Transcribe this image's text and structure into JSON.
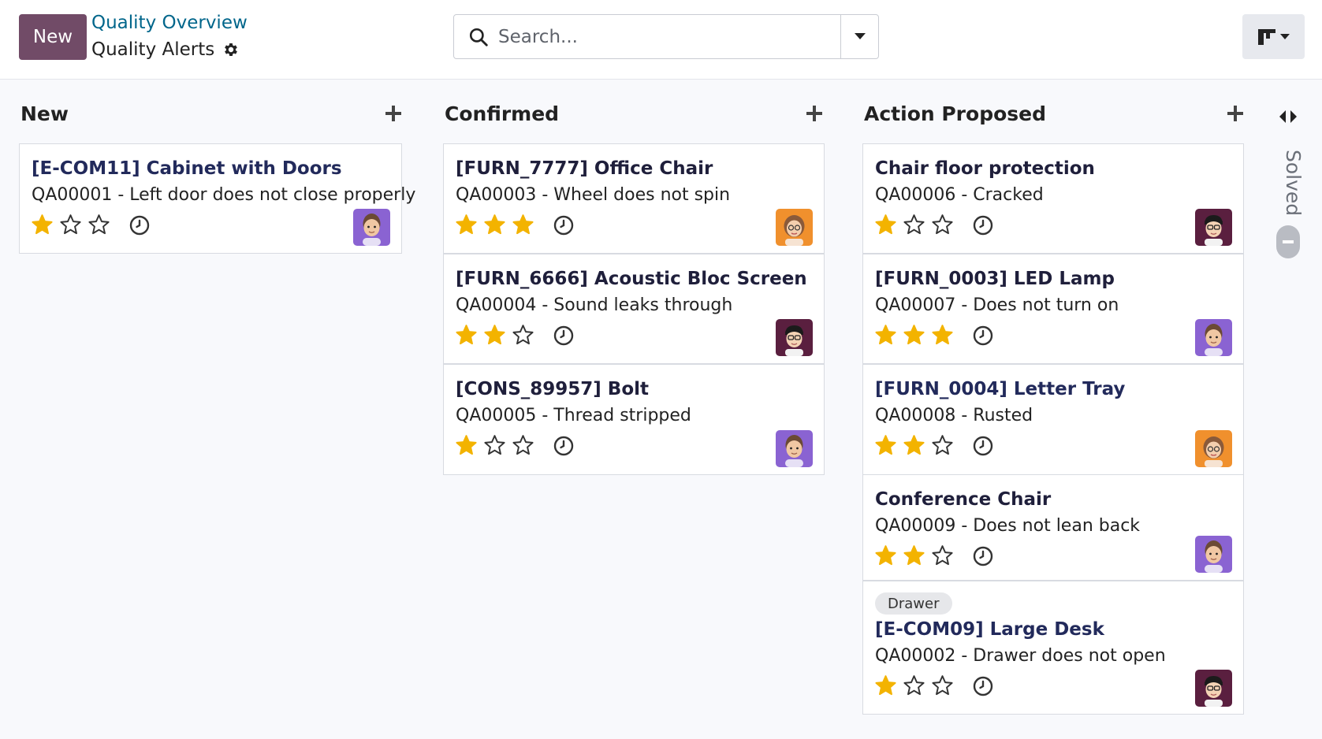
{
  "control_panel": {
    "new_button": "New",
    "breadcrumb_parent": "Quality Overview",
    "breadcrumb_current": "Quality Alerts",
    "search_placeholder": "Search..."
  },
  "colors": {
    "brand": "#714b67",
    "link": "#01668b",
    "star": "#f3b300"
  },
  "columns": [
    {
      "title": "New",
      "cards": [
        {
          "title": "[E-COM11] Cabinet with Doors",
          "subtitle": "QA00001 - Left door does not close properly",
          "priority": 1,
          "avatar": "avatar-man-purple"
        }
      ]
    },
    {
      "title": "Confirmed",
      "cards": [
        {
          "title": "[FURN_7777] Office Chair",
          "subtitle": "QA00003 - Wheel does not spin",
          "priority": 3,
          "avatar": "avatar-woman-orange"
        },
        {
          "title": "[FURN_6666] Acoustic Bloc Screen",
          "subtitle": "QA00004 - Sound leaks through",
          "priority": 2,
          "avatar": "avatar-man-glasses"
        },
        {
          "title": "[CONS_89957] Bolt",
          "subtitle": "QA00005 - Thread stripped",
          "priority": 1,
          "avatar": "avatar-man-purple"
        }
      ]
    },
    {
      "title": "Action Proposed",
      "cards": [
        {
          "title": "Chair floor protection",
          "subtitle": "QA00006 - Cracked",
          "priority": 1,
          "avatar": "avatar-man-glasses"
        },
        {
          "title": "[FURN_0003] LED Lamp",
          "subtitle": "QA00007 - Does not turn on",
          "priority": 3,
          "avatar": "avatar-man-purple"
        },
        {
          "title": "[FURN_0004] Letter Tray",
          "subtitle": "QA00008 - Rusted",
          "priority": 2,
          "avatar": "avatar-woman-orange"
        },
        {
          "title": "Conference Chair",
          "subtitle": "QA00009 - Does not lean back",
          "priority": 2,
          "avatar": "avatar-man-purple"
        },
        {
          "tag": "Drawer",
          "title": "[E-COM09] Large Desk",
          "subtitle": "QA00002 - Drawer does not open",
          "priority": 1,
          "avatar": "avatar-man-glasses"
        }
      ]
    }
  ],
  "folded_column": {
    "title": "Solved"
  }
}
